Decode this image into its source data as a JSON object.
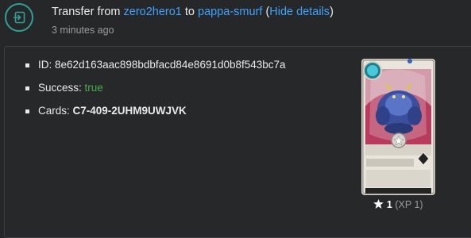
{
  "header": {
    "title_prefix": "Transfer from ",
    "from_user": "zero2hero1",
    "title_middle": " to ",
    "to_user": "pappa-smurf",
    "paren_open": " (",
    "hide_details": "Hide details",
    "paren_close": ")",
    "time_ago": "3 minutes ago",
    "icon": "transfer-in-icon"
  },
  "details": {
    "id_label": "ID: ",
    "id_value": "8e62d163aac898bdbfacd84e8691d0b8f543bc7a",
    "success_label": "Success: ",
    "success_value": "true",
    "cards_label": "Cards: ",
    "cards_value": "C7-409-2UHM9UWJVK"
  },
  "card": {
    "level": "1",
    "xp_text": "(XP 1)",
    "star_icon": "star-icon"
  },
  "colors": {
    "accent_teal": "#2ea197",
    "link_blue": "#3ea3ff",
    "success_green": "#46b04a",
    "background": "#262729"
  }
}
